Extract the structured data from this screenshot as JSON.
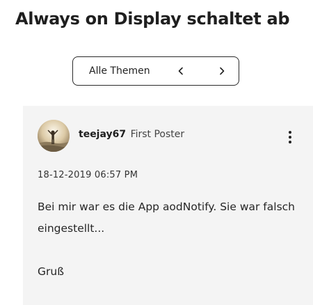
{
  "page": {
    "title": "Always on Display schaltet ab"
  },
  "pager": {
    "all_topics_label": "Alle Themen",
    "prev_icon": "chevron-left-icon",
    "next_icon": "chevron-right-icon"
  },
  "post": {
    "author": "teejay67",
    "rank": "First Poster",
    "date": "18-12-2019 06:57 PM",
    "body_line_1": "Bei mir war es die App aodNotify. Sie war falsch eingestellt...",
    "body_line_2": "Gruß",
    "menu_icon": "kebab-menu-icon"
  },
  "colors": {
    "card_background": "#f4f4f4",
    "title_text": "#1f1f1f"
  }
}
